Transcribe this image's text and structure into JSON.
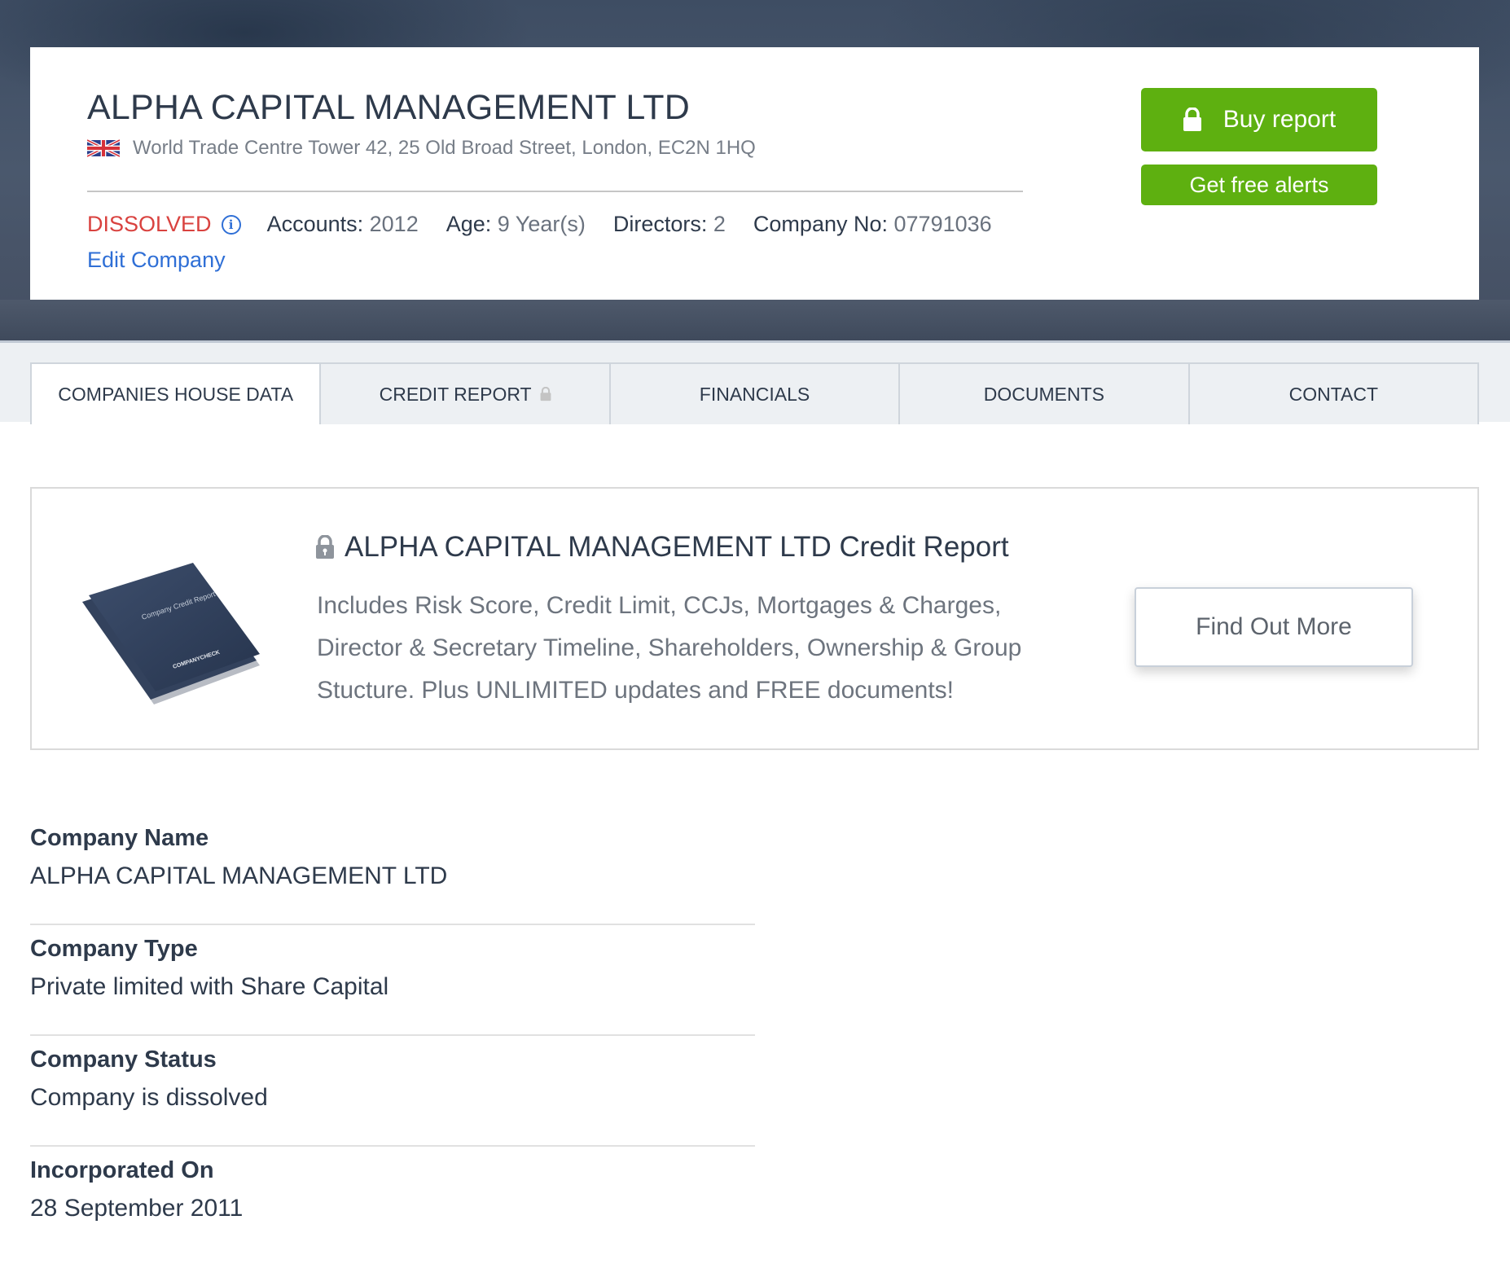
{
  "header": {
    "company_name": "ALPHA CAPITAL MANAGEMENT LTD",
    "country_flag_icon": "uk-flag-icon",
    "address": "World Trade Centre Tower 42, 25 Old Broad Street, London, EC2N 1HQ",
    "status": "DISSOLVED",
    "status_color": "#d9423f",
    "stats": [
      {
        "label": "Accounts:",
        "value": "2012"
      },
      {
        "label": "Age:",
        "value": "9 Year(s)"
      },
      {
        "label": "Directors:",
        "value": "2"
      },
      {
        "label": "Company No:",
        "value": "07791036"
      }
    ],
    "edit_link": "Edit Company",
    "buy_report_label": "Buy report",
    "free_alerts_label": "Get free alerts",
    "button_color": "#5eb010"
  },
  "tabs": [
    {
      "label": "COMPANIES HOUSE DATA",
      "active": true,
      "locked": false
    },
    {
      "label": "CREDIT REPORT",
      "active": false,
      "locked": true
    },
    {
      "label": "FINANCIALS",
      "active": false,
      "locked": false
    },
    {
      "label": "DOCUMENTS",
      "active": false,
      "locked": false
    },
    {
      "label": "CONTACT",
      "active": false,
      "locked": false
    }
  ],
  "promo": {
    "title": "ALPHA CAPITAL MANAGEMENT LTD Credit Report",
    "description": "Includes Risk Score, Credit Limit, CCJs, Mortgages & Charges, Director & Secretary Timeline, Shareholders, Ownership & Group Stucture. Plus UNLIMITED updates and FREE documents!",
    "image_cover_text": "Company Credit Report",
    "image_brand_text": "COMPANYCHECK",
    "button_label": "Find Out More"
  },
  "details": [
    {
      "label": "Company Name",
      "value": "ALPHA CAPITAL MANAGEMENT LTD"
    },
    {
      "label": "Company Type",
      "value": "Private limited with Share Capital"
    },
    {
      "label": "Company Status",
      "value": "Company is dissolved"
    },
    {
      "label": "Incorporated On",
      "value": "28 September 2011"
    }
  ]
}
